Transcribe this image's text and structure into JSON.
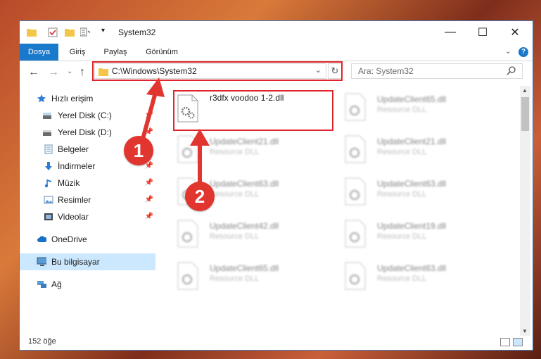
{
  "window": {
    "title": "System32",
    "controls": {
      "minimize": "—",
      "maximize": "☐",
      "close": "✕"
    }
  },
  "ribbon": {
    "tabs": [
      {
        "label": "Dosya",
        "active": true
      },
      {
        "label": "Giriş",
        "active": false
      },
      {
        "label": "Paylaş",
        "active": false
      },
      {
        "label": "Görünüm",
        "active": false
      }
    ],
    "help": "?"
  },
  "address": {
    "path": "C:\\Windows\\System32"
  },
  "search": {
    "placeholder": "Ara: System32"
  },
  "nav": {
    "items": [
      {
        "label": "Hızlı erişim",
        "icon": "star-icon",
        "pinned": false
      },
      {
        "label": "Yerel Disk (C:)",
        "icon": "drive-icon",
        "pinned": true
      },
      {
        "label": "Yerel Disk (D:)",
        "icon": "drive-icon",
        "pinned": true
      },
      {
        "label": "Belgeler",
        "icon": "documents-icon",
        "pinned": true
      },
      {
        "label": "İndirmeler",
        "icon": "download-icon",
        "pinned": true
      },
      {
        "label": "Müzik",
        "icon": "music-icon",
        "pinned": true
      },
      {
        "label": "Resimler",
        "icon": "pictures-icon",
        "pinned": true
      },
      {
        "label": "Videolar",
        "icon": "video-icon",
        "pinned": true
      },
      {
        "label": "OneDrive",
        "icon": "cloud-icon",
        "pinned": false
      },
      {
        "label": "Bu bilgisayar",
        "icon": "computer-icon",
        "pinned": false,
        "selected": true
      },
      {
        "label": "Ağ",
        "icon": "network-icon",
        "pinned": false
      }
    ]
  },
  "files": [
    {
      "name": "r3dfx voodoo 1-2.dll",
      "type": ""
    },
    {
      "name": "UpdateClient65.dll",
      "type": "Resource DLL"
    },
    {
      "name": "UpdateClient21.dll",
      "type": "Resource DLL"
    },
    {
      "name": "UpdateClient21.dll",
      "type": "Resource DLL"
    },
    {
      "name": "UpdateClient63.dll",
      "type": "Resource DLL"
    },
    {
      "name": "UpdateClient63.dll",
      "type": "Resource DLL"
    },
    {
      "name": "UpdateClient42.dll",
      "type": "Resource DLL"
    },
    {
      "name": "UpdateClient19.dll",
      "type": "Resource DLL"
    },
    {
      "name": "UpdateClient65.dll",
      "type": "Resource DLL"
    },
    {
      "name": "UpdateClient63.dll",
      "type": "Resource DLL"
    }
  ],
  "status": {
    "count": "152 öğe"
  },
  "annotations": {
    "badge1": "1",
    "badge2": "2",
    "color": "#e1352f"
  }
}
